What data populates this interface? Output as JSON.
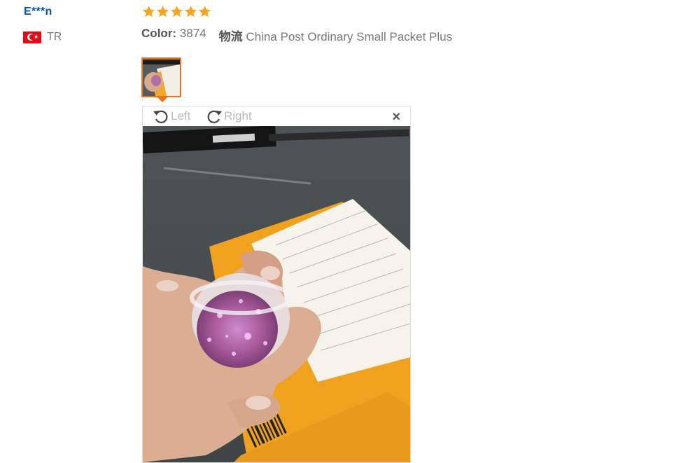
{
  "review": {
    "user_name": "E***n",
    "country_code": "TR",
    "rating": 5,
    "color_label": "Color:",
    "color_value": "3874",
    "shipping_label": "物流",
    "shipping_value": "China Post Ordinary Small Packet Plus"
  },
  "viewer": {
    "rotate_left_label": "Left",
    "rotate_right_label": "Right",
    "close_label": "×"
  },
  "colors": {
    "accent": "#e4751e",
    "star": "#f5a623",
    "username": "#0055aa"
  }
}
